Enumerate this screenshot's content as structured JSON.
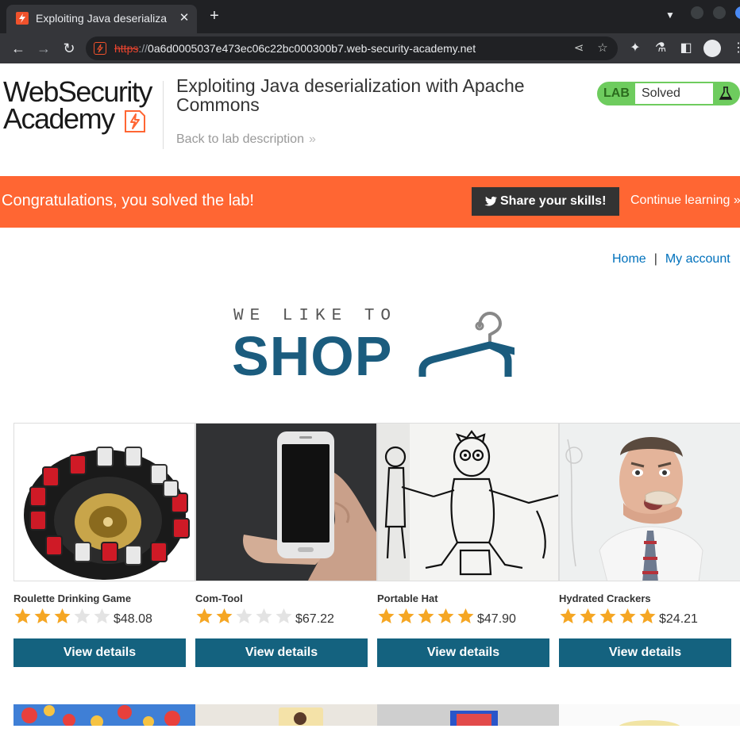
{
  "browser": {
    "tab_title": "Exploiting Java deserializa",
    "new_tab_label": "+",
    "url_scheme": "https",
    "url_sep": "://",
    "url_host": "0a6d0005037e473ec06c22bc000300b7.web-security-academy.net"
  },
  "header": {
    "logo_line1": "WebSecurity",
    "logo_line2": "Academy",
    "lab_title": "Exploiting Java deserialization with Apache Commons",
    "back_link": "Back to lab description",
    "back_chevron": "»",
    "lab_label": "LAB",
    "lab_status": "Solved"
  },
  "banner": {
    "message": "Congratulations, you solved the lab!",
    "share_label": "Share your skills!",
    "continue_label": "Continue learning",
    "continue_chevron": "»"
  },
  "nav": {
    "home": "Home",
    "separator": "|",
    "account": "My account"
  },
  "shop_logo": {
    "tagline": "WE LIKE TO",
    "word": "SHOP"
  },
  "products": [
    {
      "name": "Roulette Drinking Game",
      "rating": 3,
      "price": "$48.08",
      "button": "View details",
      "image": "roulette-image"
    },
    {
      "name": "Com-Tool",
      "rating": 2,
      "price": "$67.22",
      "button": "View details",
      "image": "phone-in-hand-image"
    },
    {
      "name": "Portable Hat",
      "rating": 5,
      "price": "$47.90",
      "button": "View details",
      "image": "cartoon-sketch-image"
    },
    {
      "name": "Hydrated Crackers",
      "rating": 5,
      "price": "$24.21",
      "button": "View details",
      "image": "man-eating-cracker-image"
    }
  ],
  "colors": {
    "brand_orange": "#ff6633",
    "solved_green": "#6ecc5e",
    "button_blue": "#14627f",
    "link_blue": "#0071bc",
    "star_gold": "#f5a623",
    "star_empty": "#e3e3e3"
  }
}
